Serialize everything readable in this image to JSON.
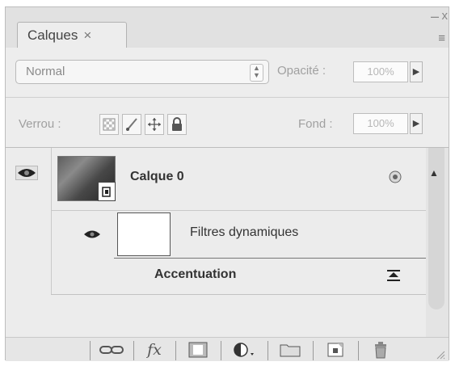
{
  "panel": {
    "tab_label": "Calques",
    "tab_close": "×",
    "window_controls": {
      "minimize": "–",
      "close": "x",
      "menu": "≡"
    }
  },
  "blend": {
    "mode": "Normal",
    "stepper_up": "▲",
    "stepper_down": "▼",
    "opacity_label": "Opacité :",
    "opacity_value": "100%",
    "arrow": "▶"
  },
  "lock": {
    "label": "Verrou :",
    "icons": [
      "lock-transparent-pixels-icon",
      "lock-image-pixels-icon",
      "lock-position-icon",
      "lock-all-icon"
    ],
    "fill_label": "Fond :",
    "fill_value": "100%",
    "arrow": "▶"
  },
  "layers": [
    {
      "name": "Calque 0",
      "visible": true,
      "type": "smart-object",
      "filters_label": "Filtres dynamiques",
      "filters": [
        {
          "name": "Accentuation"
        }
      ]
    }
  ],
  "bottom_toolbar": {
    "buttons": [
      "link-layers-icon",
      "layer-style-fx-icon",
      "add-mask-icon",
      "adjustment-layer-icon",
      "new-group-icon",
      "new-layer-icon",
      "delete-layer-icon"
    ],
    "fx_text": "fx"
  },
  "colors": {
    "panel_bg": "#e9e9e9",
    "border": "#bdbdbd",
    "text": "#333333",
    "muted": "#a0a0a0"
  }
}
